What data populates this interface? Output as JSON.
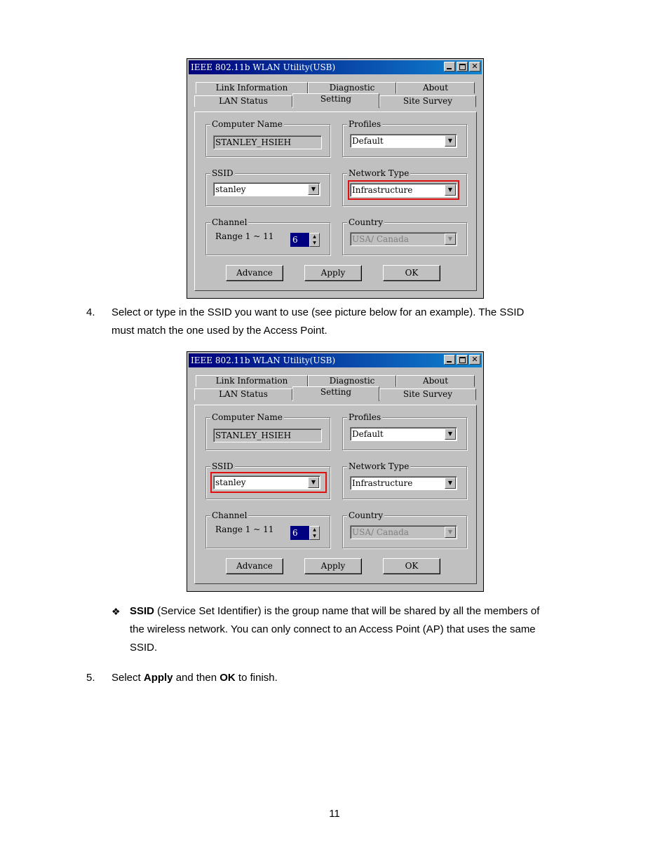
{
  "dialog": {
    "title": "IEEE 802.11b WLAN Utility(USB)",
    "close_glyph": "✕",
    "tabs_back": [
      "Link Information",
      "Diagnostic",
      "About"
    ],
    "tabs_front": [
      "LAN Status",
      "Setting",
      "Site Survey"
    ],
    "active_tab": "Setting",
    "computer_name_label": "Computer Name",
    "computer_name_value": "STANLEY_HSIEH",
    "profiles_label": "Profiles",
    "profiles_value": "Default",
    "ssid_label": "SSID",
    "ssid_value": "stanley",
    "network_type_label": "Network Type",
    "network_type_value": "Infrastructure",
    "channel_label": "Channel",
    "channel_range": "Range 1 ~ 11",
    "channel_value": "6",
    "country_label": "Country",
    "country_value": "USA/ Canada",
    "buttons": [
      "Advance",
      "Apply",
      "OK"
    ],
    "dropdown_arrow": "▼",
    "spin_up": "▲",
    "spin_down": "▼"
  },
  "highlight_color": "#e01010",
  "step4": {
    "number": "4.",
    "line1": "Select or type in the SSID you want to use (see picture below for an example).   The SSID",
    "line2": "must match the one used by the Access Point."
  },
  "bullet": {
    "symbol": "❖",
    "term": "SSID",
    "line1_rest": " (Service Set Identifier) is the group name that will be shared by all the members of",
    "line2": "the wireless network. You can only connect to an Access Point (AP) that uses the same",
    "line3": "SSID."
  },
  "step5": {
    "number": "5.",
    "pre": "Select ",
    "apply": "Apply",
    "mid": " and then ",
    "ok": "OK",
    "post": " to finish."
  },
  "page_number": "11"
}
